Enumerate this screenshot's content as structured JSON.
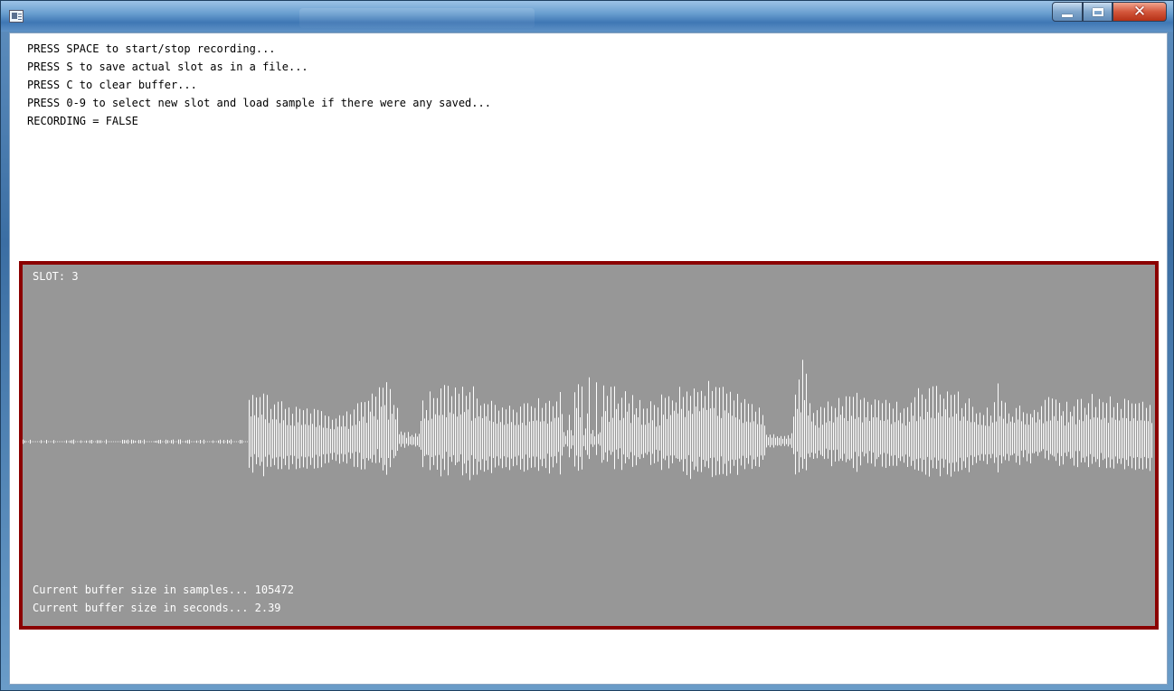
{
  "window": {
    "title": "",
    "controls": {
      "minimize": "minimize",
      "maximize": "maximize",
      "close": "close"
    }
  },
  "instructions": [
    "PRESS SPACE to start/stop recording...",
    "PRESS S to save actual slot as in a file...",
    "PRESS C to clear buffer...",
    "PRESS 0-9 to select new slot and load sample if there were any saved...",
    "RECORDING = FALSE"
  ],
  "panel": {
    "slot_label": "SLOT: 3",
    "samples_text": "Current buffer size in samples... 105472",
    "seconds_text": "Current buffer size in seconds... 2.39",
    "colors": {
      "background": "#979797",
      "border": "#8b0000",
      "wave": "#ffffff"
    }
  }
}
